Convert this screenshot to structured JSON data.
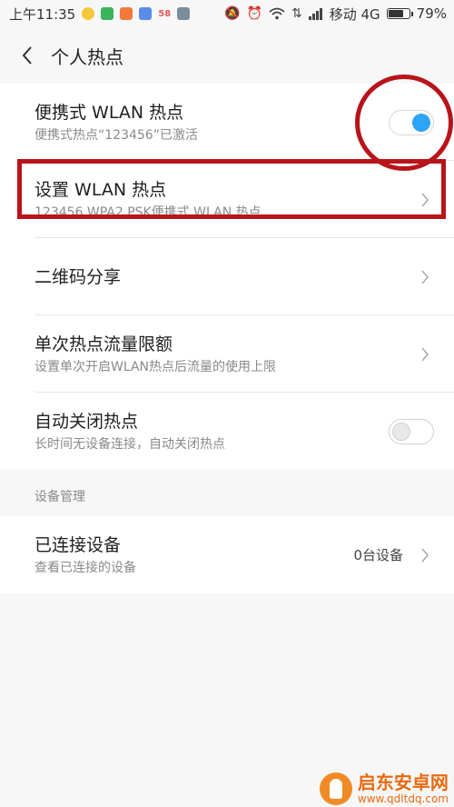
{
  "status_bar": {
    "time": "上午11:35",
    "app_icon_colors": [
      "#f4c83a",
      "#39b45a",
      "#f4793b",
      "#5a8be8",
      "#e85a5a",
      "#7a8d9a"
    ],
    "app_icon_label": "58",
    "carrier": "移动 4G",
    "battery_percent": "79%",
    "battery_level": 0.79
  },
  "header": {
    "title": "个人热点"
  },
  "hotspot": {
    "title": "便携式 WLAN 热点",
    "subtitle": "便携式热点“123456”已激活",
    "enabled": true
  },
  "setup": {
    "title": "设置 WLAN 热点",
    "subtitle": "123456 WPA2 PSK便携式 WLAN 热点"
  },
  "qr": {
    "title": "二维码分享"
  },
  "data_limit": {
    "title": "单次热点流量限额",
    "subtitle": "设置单次开启WLAN热点后流量的使用上限"
  },
  "auto_off": {
    "title": "自动关闭热点",
    "subtitle": "长时间无设备连接，自动关闭热点",
    "enabled": false
  },
  "device_section": {
    "label": "设备管理"
  },
  "connected": {
    "title": "已连接设备",
    "subtitle": "查看已连接的设备",
    "value": "0台设备"
  },
  "watermark": {
    "name": "启东安卓网",
    "url": "www.qdltdq.com"
  },
  "colors": {
    "accent": "#2fa3f6",
    "annotation": "#b8141a"
  }
}
